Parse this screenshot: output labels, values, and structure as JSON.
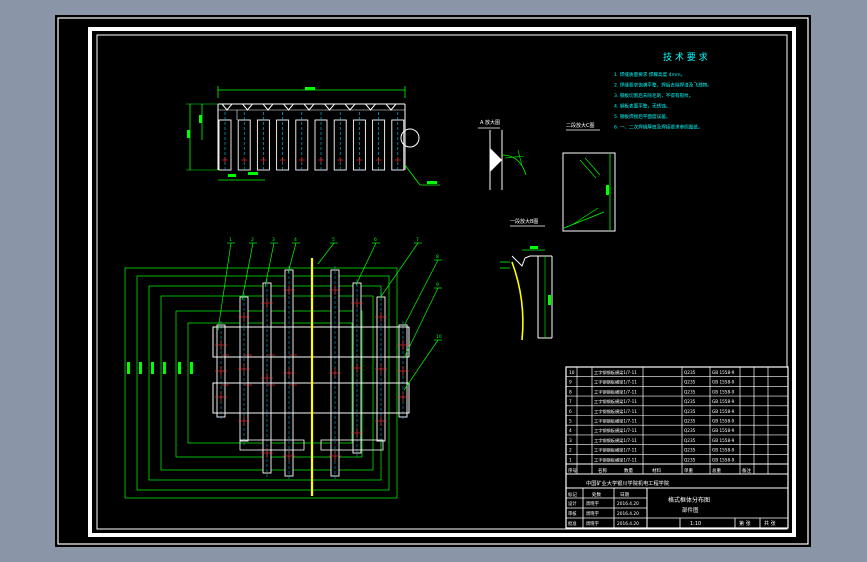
{
  "app": {
    "viewport_bg": "#8a95a8",
    "sheet_bg": "#000000",
    "frame_color": "#ffffff"
  },
  "colors": {
    "outline": "#ffffff",
    "dimension": "#00ff00",
    "centerline": "#ff3030",
    "hidden": "#00c8ff",
    "leader": "#00ff00",
    "highlight": "#ffff00",
    "title_text": "#00ffff",
    "table_text": "#ffffff"
  },
  "tech_requirements": {
    "title": "技 术 要 求",
    "items": [
      "1. 焊缝质量要求 焊脚高度 4mm。",
      "2. 焊缝要求饱满平整，焊后去除焊渣及飞溅物。",
      "3. 钢板切割后去除毛刺，不得有裂纹。",
      "4. 钢板表面平整，无锈蚀。",
      "5. 钢板焊接后平面度误差。",
      "6. 一、二次焊缝厚度及焊接要求参照图纸。"
    ]
  },
  "section_labels": {
    "a": "A 放大图",
    "b": "一段放大B图",
    "c": "二段放大C图"
  },
  "title_block": {
    "company": "中国矿业大学银川学院机电工程学院",
    "drawing_name": "格式框体分布图",
    "drawing_sub": "部件图",
    "scale": "1:10",
    "sheet": "第 张",
    "total": "共 张",
    "rows": [
      {
        "no": "10",
        "name": "工字钢钢板横梁1/7-11",
        "mat": "Q235",
        "std": "GB 1558-9"
      },
      {
        "no": "9",
        "name": "工字钢钢板横梁1/7-11",
        "mat": "Q235",
        "std": "GB 1558-9"
      },
      {
        "no": "8",
        "name": "工字钢钢板横梁1/7-11",
        "mat": "Q235",
        "std": "GB 1558-9"
      },
      {
        "no": "7",
        "name": "工字钢钢板横梁1/7-11",
        "mat": "Q235",
        "std": "GB 1558-9"
      },
      {
        "no": "6",
        "name": "工字钢钢板横梁1/7-11",
        "mat": "Q235",
        "std": "GB 1558-9"
      },
      {
        "no": "5",
        "name": "工字钢钢板横梁1/7-11",
        "mat": "Q235",
        "std": "GB 1558-9"
      },
      {
        "no": "4",
        "name": "工字钢钢板横梁1/7-11",
        "mat": "Q235",
        "std": "GB 1558-9"
      },
      {
        "no": "3",
        "name": "工字钢钢板横梁1/7-11",
        "mat": "Q235",
        "std": "GB 1558-9"
      },
      {
        "no": "2",
        "name": "工字钢钢板横梁1/7-11",
        "mat": "Q235",
        "std": "GB 1558-9"
      },
      {
        "no": "1",
        "name": "工字钢钢板横梁1/7-11",
        "mat": "Q235",
        "std": "GB 1558-9"
      }
    ],
    "header": [
      "序号",
      "名称",
      "数量",
      "材料",
      "单重",
      "总重",
      "备注"
    ],
    "sign_rows": [
      {
        "role": "设计",
        "name": "周晓宇",
        "date": "2016.4.20"
      },
      {
        "role": "审核",
        "name": "周晓宇",
        "date": "2016.4.20"
      },
      {
        "role": "批准",
        "name": "周晓宇",
        "date": "2016.4.20"
      }
    ],
    "sign_header": [
      "标记",
      "处数",
      "日期"
    ]
  },
  "leaders": [
    "1",
    "2",
    "3",
    "4",
    "5",
    "6",
    "7",
    "8",
    "9",
    "10"
  ]
}
